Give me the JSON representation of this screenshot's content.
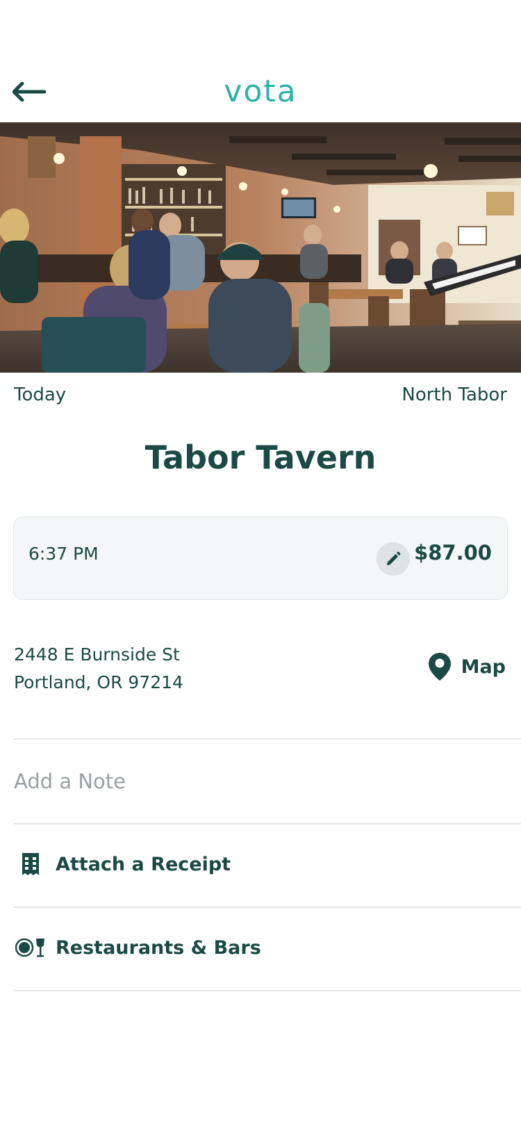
{
  "app": {
    "logo_text": "vota",
    "brand_color": "#2bb3a3",
    "text_color": "#1b4a44"
  },
  "header": {
    "back_icon": "arrow-left-icon"
  },
  "hero": {
    "image_subject": "restaurant interior with diners at a bar"
  },
  "meta": {
    "date": "Today",
    "neighborhood": "North Tabor"
  },
  "merchant": {
    "name": "Tabor Tavern"
  },
  "transaction": {
    "time": "6:37 PM",
    "amount": "$87.00",
    "edit_icon": "pencil-icon"
  },
  "address": {
    "line1": "2448 E Burnside St",
    "line2": "Portland, OR 97214",
    "map_label": "Map",
    "map_icon": "map-pin-icon"
  },
  "note": {
    "placeholder": "Add a Note"
  },
  "receipt": {
    "label": "Attach a Receipt",
    "icon": "receipt-icon"
  },
  "category": {
    "label": "Restaurants & Bars",
    "icon": "dining-icon"
  }
}
